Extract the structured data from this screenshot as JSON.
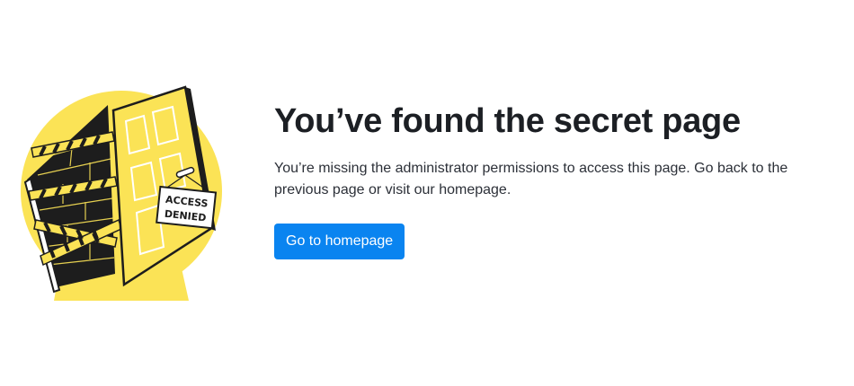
{
  "illustration": {
    "sign_line1": "ACCESS",
    "sign_line2": "DENIED",
    "icon": "open-door-with-caution-tape"
  },
  "heading": "You’ve found the secret page",
  "description": "You’re missing the administrator permissions to access this page. Go back to the previous page or visit our homepage.",
  "button_label": "Go to homepage",
  "colors": {
    "accent_yellow": "#fbe356",
    "button_blue": "#0a84f0",
    "ink": "#1b1b1b"
  }
}
